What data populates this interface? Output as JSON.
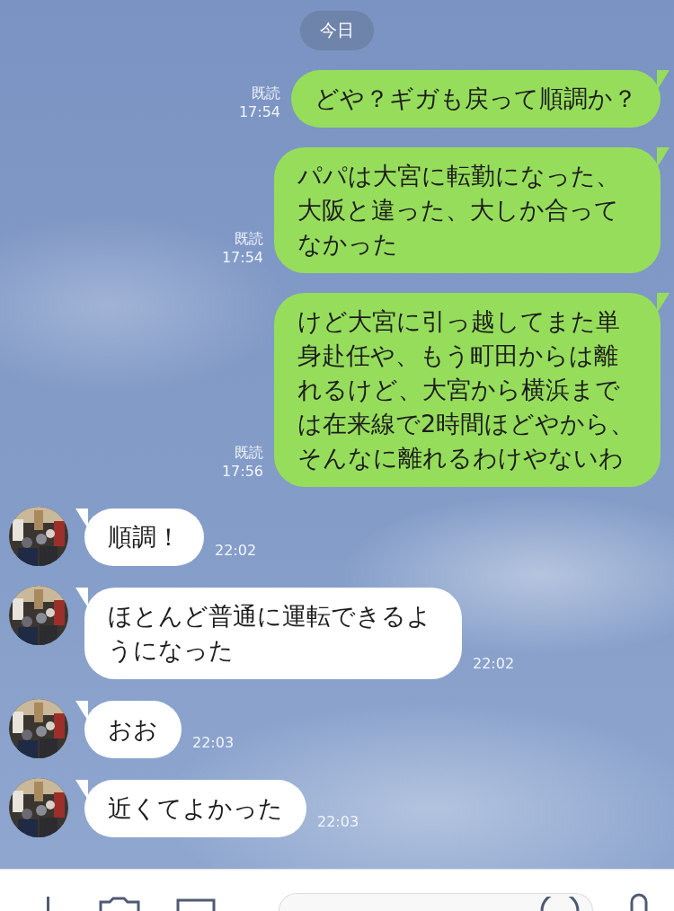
{
  "date_label": "今日",
  "messages": [
    {
      "kind": "sent",
      "read": "既読",
      "time": "17:54",
      "text": "どや？ギガも戻って順調か？"
    },
    {
      "kind": "sent",
      "read": "既読",
      "time": "17:54",
      "text": "パパは大宮に転勤になった、大阪と違った、大しか合ってなかった"
    },
    {
      "kind": "sent",
      "read": "既読",
      "time": "17:56",
      "text": "けど大宮に引っ越してまた単身赴任や、もう町田からは離れるけど、大宮から横浜までは在来線で2時間ほどやから、そんなに離れるわけやないわ"
    },
    {
      "kind": "received",
      "time": "22:02",
      "text": "順調！"
    },
    {
      "kind": "received",
      "time": "22:02",
      "text": "ほとんど普通に運転できるようになった"
    },
    {
      "kind": "received",
      "time": "22:03",
      "text": "おお"
    },
    {
      "kind": "received",
      "time": "22:03",
      "text": "近くてよかった"
    }
  ]
}
